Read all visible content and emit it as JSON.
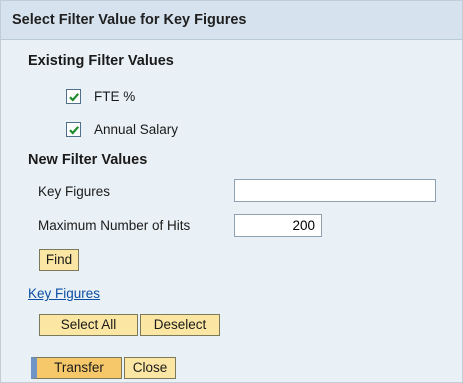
{
  "dialog": {
    "title": "Select Filter Value for Key Figures"
  },
  "existing": {
    "heading": "Existing Filter Values",
    "items": [
      {
        "label": "FTE %",
        "checked": true
      },
      {
        "label": "Annual Salary",
        "checked": true
      }
    ]
  },
  "new_filter": {
    "heading": "New Filter Values",
    "key_figures_label": "Key Figures",
    "key_figures_value": "",
    "max_hits_label": "Maximum Number of Hits",
    "max_hits_value": "200",
    "find_label": "Find"
  },
  "key_figures_link": "Key Figures",
  "selection": {
    "select_all_label": "Select All",
    "deselect_label": "Deselect"
  },
  "footer": {
    "transfer_label": "Transfer",
    "close_label": "Close"
  },
  "colors": {
    "title_bar": "#d6e3ee",
    "panel_background": "#eaf1f6",
    "button_background": "#fbe7a3",
    "primary_button_accent": "#6f95c7",
    "checkmark": "#1e8c2e",
    "link": "#0b4ea2"
  }
}
